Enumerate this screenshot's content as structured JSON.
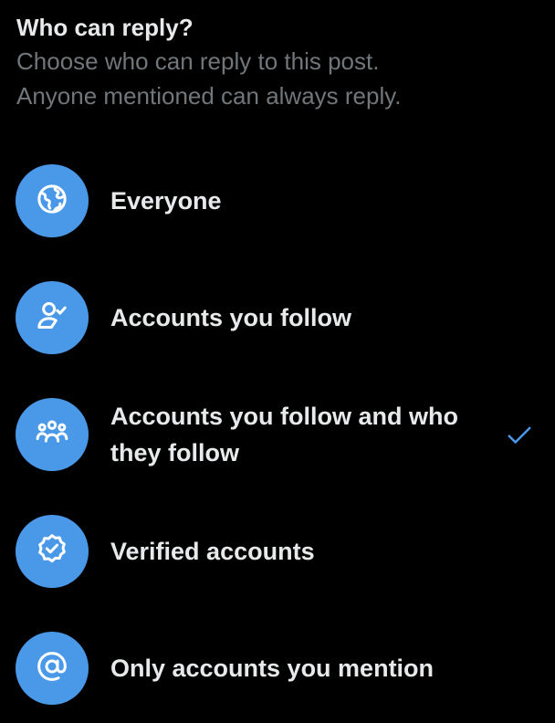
{
  "header": {
    "title": "Who can reply?",
    "subtitle_line1": "Choose who can reply to this post.",
    "subtitle_line2": "Anyone mentioned can always reply."
  },
  "colors": {
    "background": "#000000",
    "accent": "#4a99e9",
    "text_primary": "#e7e9ea",
    "text_secondary": "#71767b"
  },
  "options": [
    {
      "label": "Everyone",
      "icon": "globe-icon",
      "selected": false
    },
    {
      "label": "Accounts you follow",
      "icon": "person-check-icon",
      "selected": false
    },
    {
      "label": "Accounts you follow and who they follow",
      "icon": "group-icon",
      "selected": true
    },
    {
      "label": "Verified accounts",
      "icon": "verified-badge-icon",
      "selected": false
    },
    {
      "label": "Only accounts you mention",
      "icon": "at-sign-icon",
      "selected": false
    }
  ]
}
